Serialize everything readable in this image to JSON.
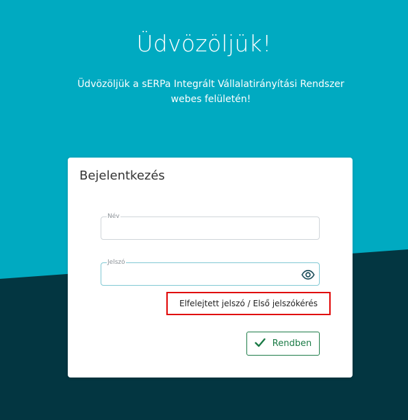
{
  "colors": {
    "bg_top": "#00aac1",
    "bg_bottom": "#033641",
    "accent_green": "#1a7a45",
    "highlight_red": "#e00000"
  },
  "hero": {
    "title": "Üdvözöljük!",
    "subtitle_line1": "Üdvözöljük a sERPa Integrált Vállalatirányítási Rendszer",
    "subtitle_line2": "webes felületén!"
  },
  "login": {
    "title": "Bejelentkezés",
    "name_label": "Név",
    "name_value": "",
    "password_label": "Jelszó",
    "password_value": "",
    "password_toggle_icon": "eye-icon",
    "forgot_link": "Elfelejtett jelszó / Első jelszókérés",
    "submit_label": "Rendben",
    "submit_icon": "check-icon"
  }
}
